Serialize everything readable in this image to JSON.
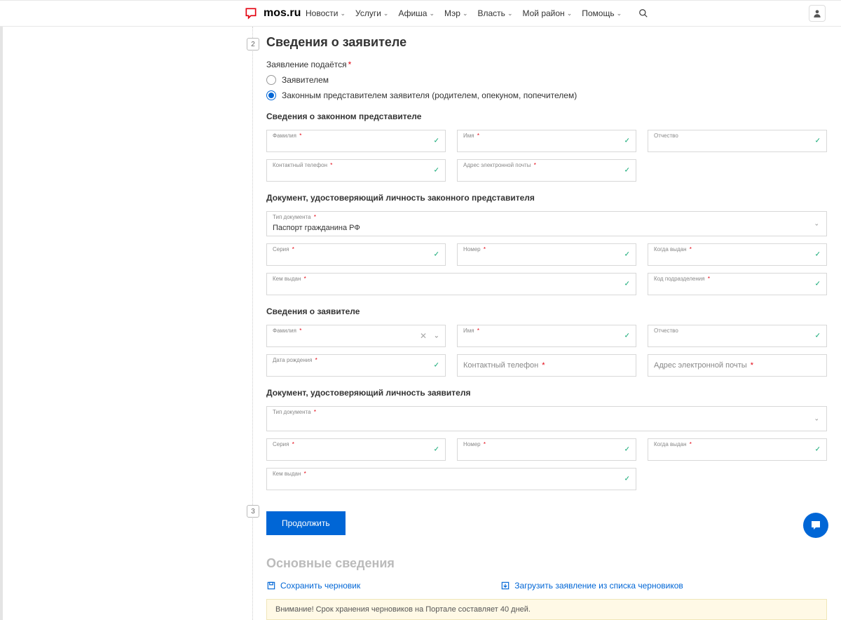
{
  "header": {
    "logo": "mos.ru",
    "nav": [
      "Новости",
      "Услуги",
      "Афиша",
      "Мэр",
      "Власть",
      "Мой район",
      "Помощь"
    ]
  },
  "step2": {
    "num": "2",
    "title": "Сведения о заявителе",
    "filed_by_label": "Заявление подаётся",
    "radio1": "Заявителем",
    "radio2": "Законным представителем заявителя (родителем, опекуном, попечителем)",
    "rep_section": "Сведения о законном представителе",
    "f_lastname": "Фамилия",
    "f_firstname": "Имя",
    "f_middlename": "Отчество",
    "f_phone": "Контактный телефон",
    "f_email": "Адрес электронной почты",
    "doc_rep_section": "Документ, удостоверяющий личность законного представителя",
    "f_doctype": "Тип документа",
    "v_doctype": "Паспорт гражданина РФ",
    "f_series": "Серия",
    "f_number": "Номер",
    "f_issued_when": "Когда выдан",
    "f_issued_by": "Кем выдан",
    "f_dept_code": "Код подразделения",
    "app_section": "Сведения о заявителе",
    "f_dob": "Дата рождения",
    "f_phone2": "Контактный телефон",
    "f_email2": "Адрес электронной почты",
    "doc_app_section": "Документ, удостоверяющий личность заявителя",
    "btn_continue": "Продолжить"
  },
  "step3": {
    "num": "3",
    "title": "Основные сведения"
  },
  "actions": {
    "save_draft": "Сохранить черновик",
    "load_draft": "Загрузить заявление из списка черновиков"
  },
  "warning": "Внимание! Срок хранения черновиков на Портале составляет 40 дней."
}
